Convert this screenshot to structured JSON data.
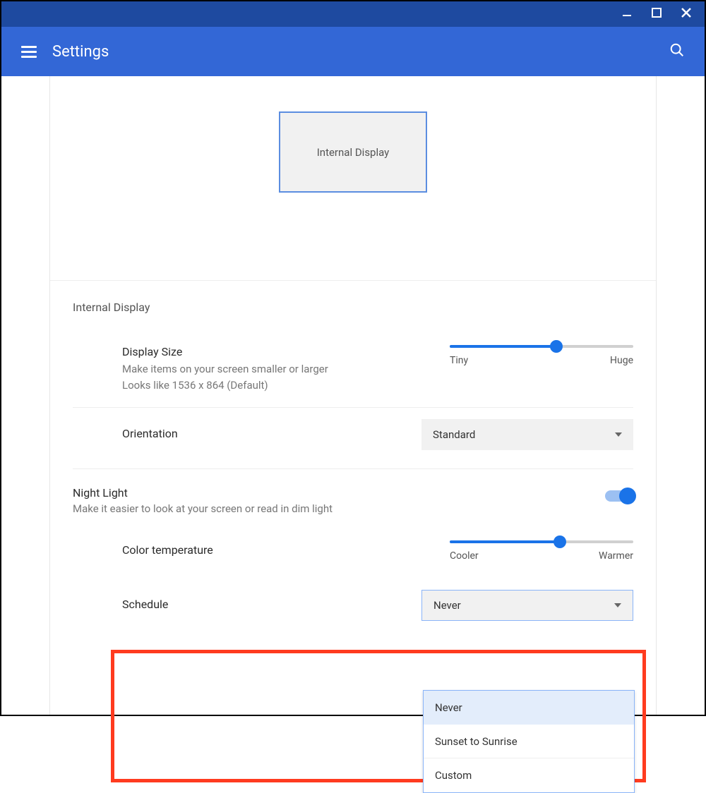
{
  "app_title": "Settings",
  "display_preview_label": "Internal Display",
  "section_internal_display": "Internal Display",
  "display_size": {
    "title": "Display Size",
    "sub1": "Make items on your screen smaller or larger",
    "sub2": "Looks like 1536 x 864 (Default)",
    "min_label": "Tiny",
    "max_label": "Huge",
    "value_percent": 58
  },
  "orientation": {
    "title": "Orientation",
    "value": "Standard"
  },
  "night_light": {
    "title": "Night Light",
    "sub": "Make it easier to look at your screen or read in dim light",
    "enabled": true
  },
  "color_temp": {
    "title": "Color temperature",
    "min_label": "Cooler",
    "max_label": "Warmer",
    "value_percent": 60
  },
  "schedule": {
    "title": "Schedule",
    "value": "Never",
    "options": [
      "Never",
      "Sunset to Sunrise",
      "Custom"
    ]
  }
}
